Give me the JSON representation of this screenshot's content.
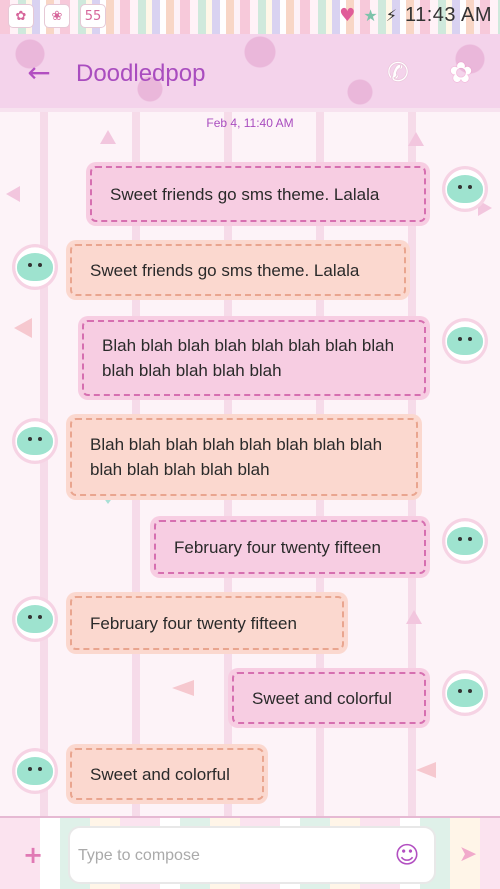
{
  "status_bar": {
    "time": "11:43 AM",
    "left_icons": [
      "hello-kitty-icon",
      "hello-kitty-icon",
      "notification-icon"
    ],
    "right_icons": [
      "heart-icon",
      "signal-icon",
      "battery-charging-icon"
    ],
    "notification_count": "55"
  },
  "app_bar": {
    "title": "Doodledpop",
    "back_icon": "arrow-left-icon",
    "call_icon": "phone-icon",
    "theme_icon": "flower-icon"
  },
  "chat": {
    "timestamp": "Feb 4, 11:40 AM",
    "messages": [
      {
        "direction": "out",
        "text": "Sweet friends go sms theme. Lalala"
      },
      {
        "direction": "in",
        "text": "Sweet friends go sms theme. Lalala"
      },
      {
        "direction": "out",
        "text": "Blah blah blah blah blah blah blah blah blah blah blah blah blah"
      },
      {
        "direction": "in",
        "text": "Blah blah blah blah blah blah blah blah blah blah blah blah blah"
      },
      {
        "direction": "out",
        "text": "February four twenty fifteen"
      },
      {
        "direction": "in",
        "text": "February four twenty fifteen"
      },
      {
        "direction": "out",
        "text": "Sweet and colorful"
      },
      {
        "direction": "in",
        "text": "Sweet and colorful"
      }
    ]
  },
  "composer": {
    "placeholder": "Type to compose",
    "value": ""
  },
  "colors": {
    "accent": "#a94dbf",
    "outgoing_bubble": "#f7cde2",
    "incoming_bubble": "#fbd8cf",
    "avatar_owl": "#9ee3cf"
  }
}
